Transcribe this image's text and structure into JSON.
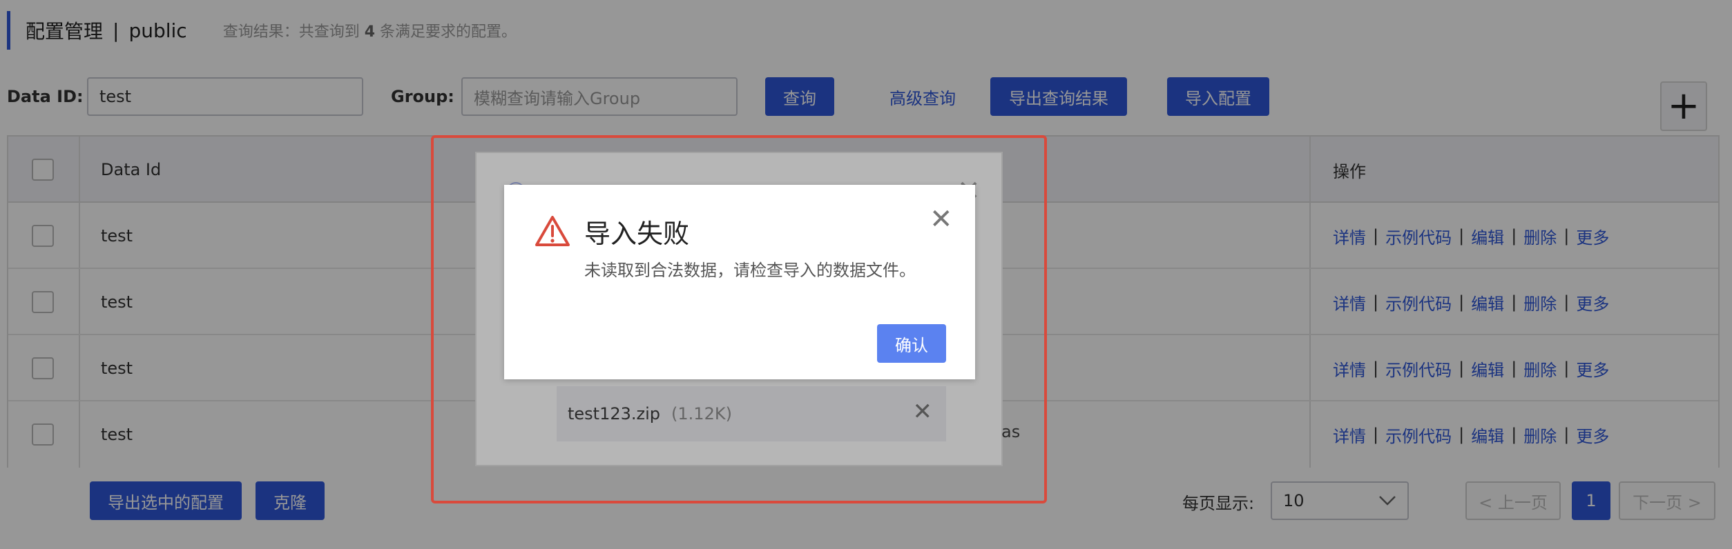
{
  "header": {
    "title": "配置管理",
    "separator": "|",
    "namespace": "public",
    "result_prefix": "查询结果：共查询到",
    "result_count": "4",
    "result_suffix": "条满足要求的配置。"
  },
  "search": {
    "data_id_label": "Data ID:",
    "data_id_value": "test",
    "group_label": "Group:",
    "group_placeholder": "模糊查询请输入Group",
    "query_button": "查询",
    "advanced_link": "高级查询",
    "export_results_button": "导出查询结果",
    "import_button": "导入配置",
    "add_icon": "+"
  },
  "table": {
    "columns": [
      "Data Id",
      "操作"
    ],
    "rows": [
      {
        "data_id": "test"
      },
      {
        "data_id": "test"
      },
      {
        "data_id": "test"
      },
      {
        "data_id": "test",
        "partial_text": "as"
      }
    ],
    "ops": [
      "详情",
      "示例代码",
      "编辑",
      "删除",
      "更多"
    ],
    "op_sep": "|"
  },
  "footer": {
    "export_selected_button": "导出选中的配置",
    "clone_button": "克隆",
    "page_size_label": "每页显示:",
    "page_size_value": "10",
    "prev_page": "< 上一页",
    "current_page": "1",
    "next_page": "下一页 >"
  },
  "import_dialog": {
    "file_name": "test123.zip",
    "file_size": "(1.12K)"
  },
  "error_dialog": {
    "title": "导入失败",
    "message": "未读取到合法数据，请检查导入的数据文件。",
    "ok_button": "确认"
  },
  "colors": {
    "primary": "#2f58d8",
    "warning": "#d94a3c",
    "annotation": "#d94a3c"
  }
}
